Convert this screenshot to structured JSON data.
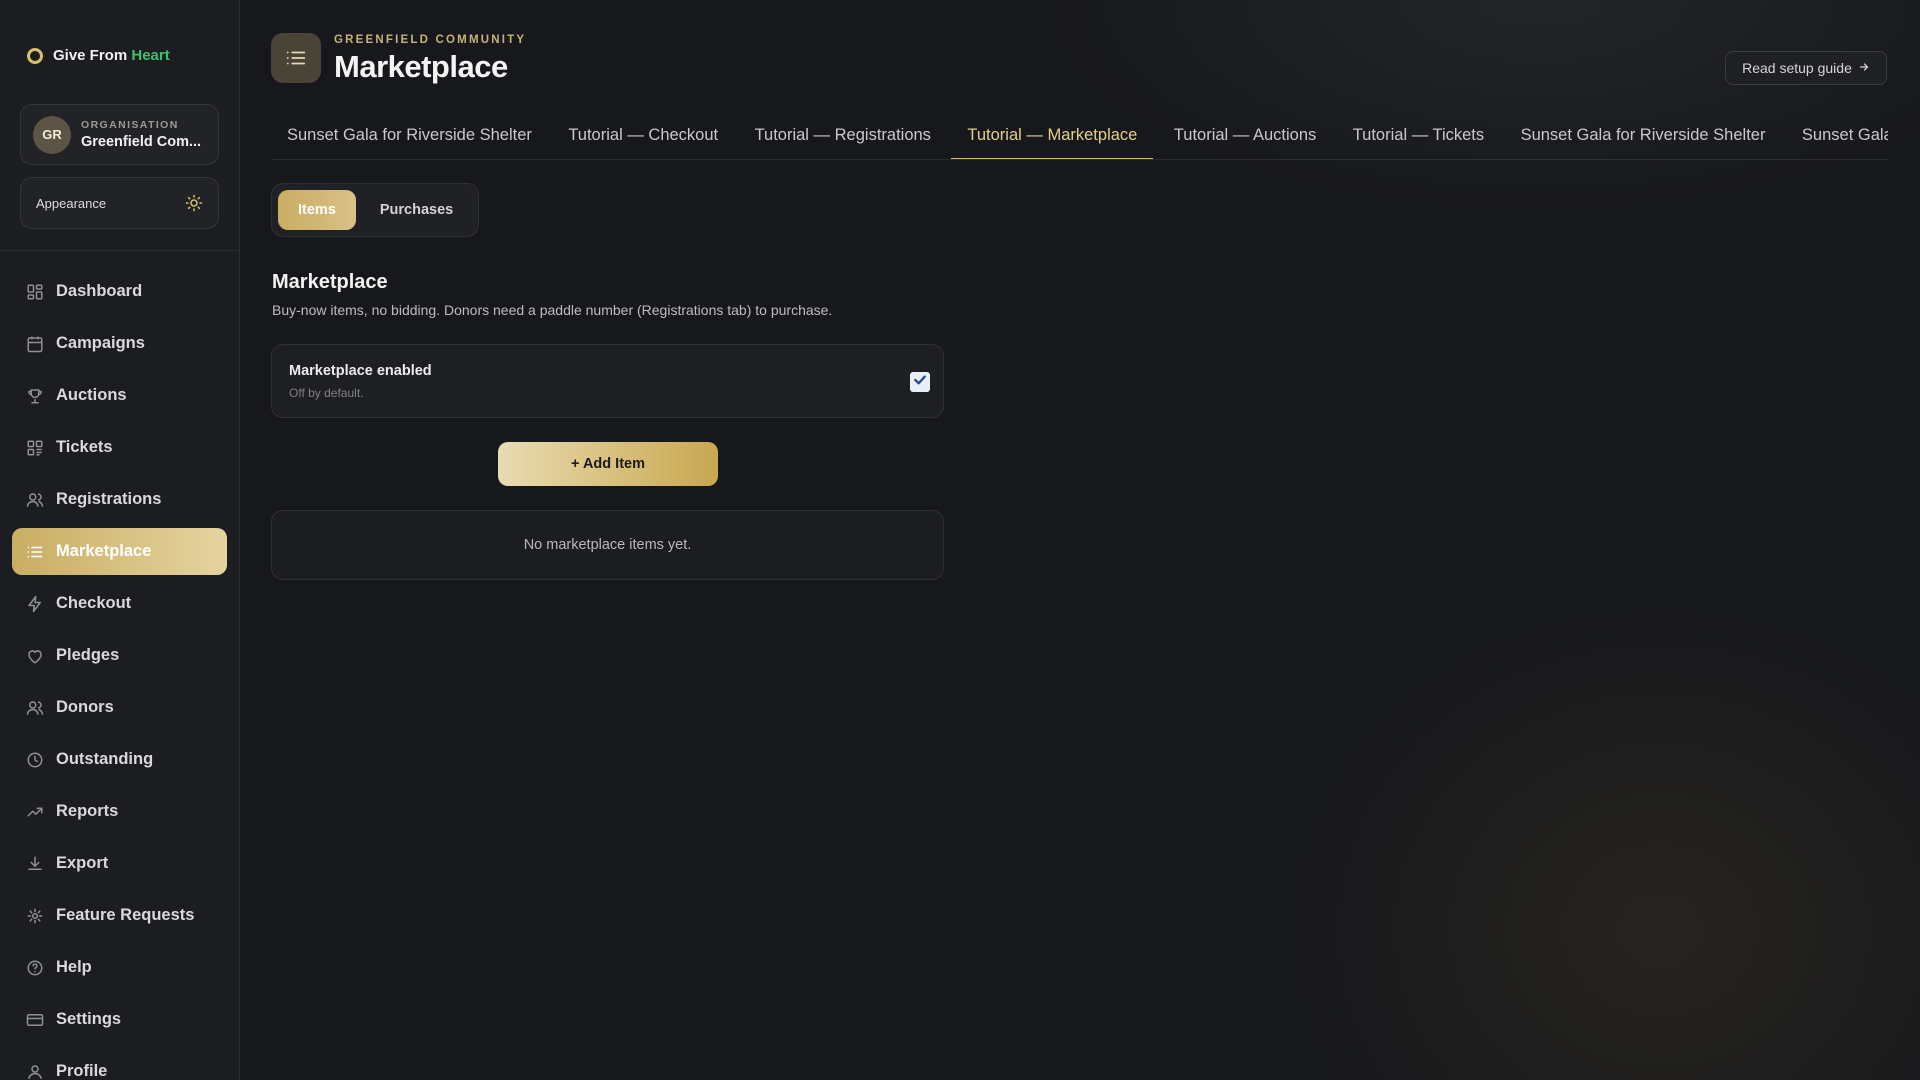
{
  "brand": {
    "name_prefix": "Give From",
    "name_accent": "Heart"
  },
  "org": {
    "initials": "GR",
    "label": "ORGANISATION",
    "name": "Greenfield Com..."
  },
  "appearance": {
    "label": "Appearance",
    "icon": "sun-icon"
  },
  "sidebar": {
    "items": [
      {
        "label": "Dashboard",
        "icon": "dashboard-icon"
      },
      {
        "label": "Campaigns",
        "icon": "calendar-icon"
      },
      {
        "label": "Auctions",
        "icon": "trophy-icon"
      },
      {
        "label": "Tickets",
        "icon": "ticket-grid-icon"
      },
      {
        "label": "Registrations",
        "icon": "users-icon"
      },
      {
        "label": "Marketplace",
        "icon": "list-icon",
        "active": true
      },
      {
        "label": "Checkout",
        "icon": "bolt-icon"
      },
      {
        "label": "Pledges",
        "icon": "heart-icon"
      },
      {
        "label": "Donors",
        "icon": "users-icon"
      },
      {
        "label": "Outstanding",
        "icon": "clock-icon"
      },
      {
        "label": "Reports",
        "icon": "trend-icon"
      },
      {
        "label": "Export",
        "icon": "download-icon"
      },
      {
        "label": "Feature Requests",
        "icon": "sparkle-icon"
      },
      {
        "label": "Help",
        "icon": "help-icon"
      },
      {
        "label": "Settings",
        "icon": "card-icon"
      },
      {
        "label": "Profile",
        "icon": "user-icon"
      }
    ]
  },
  "header": {
    "eyebrow": "GREENFIELD COMMUNITY",
    "title": "Marketplace",
    "guide_label": "Read setup guide",
    "guide_icon": "arrow-right-icon"
  },
  "tabs": [
    {
      "label": "Sunset Gala for Riverside Shelter"
    },
    {
      "label": "Tutorial — Checkout"
    },
    {
      "label": "Tutorial — Registrations"
    },
    {
      "label": "Tutorial — Marketplace",
      "active": true
    },
    {
      "label": "Tutorial — Auctions"
    },
    {
      "label": "Tutorial — Tickets"
    },
    {
      "label": "Sunset Gala for Riverside Shelter"
    },
    {
      "label": "Sunset Gala for Riverside Shelter"
    }
  ],
  "segments": {
    "items": "Items",
    "purchases": "Purchases",
    "active": "Items"
  },
  "section": {
    "title": "Marketplace",
    "description": "Buy-now items, no bidding. Donors need a paddle number (Registrations tab) to purchase."
  },
  "setting": {
    "label": "Marketplace enabled",
    "hint": "Off by default.",
    "checked": true
  },
  "add_button": "+ Add Item",
  "empty_state": "No marketplace items yet.",
  "colors": {
    "accent_gold": "#d8bd6f",
    "brand_green": "#38c46a",
    "background": "#17181b"
  }
}
